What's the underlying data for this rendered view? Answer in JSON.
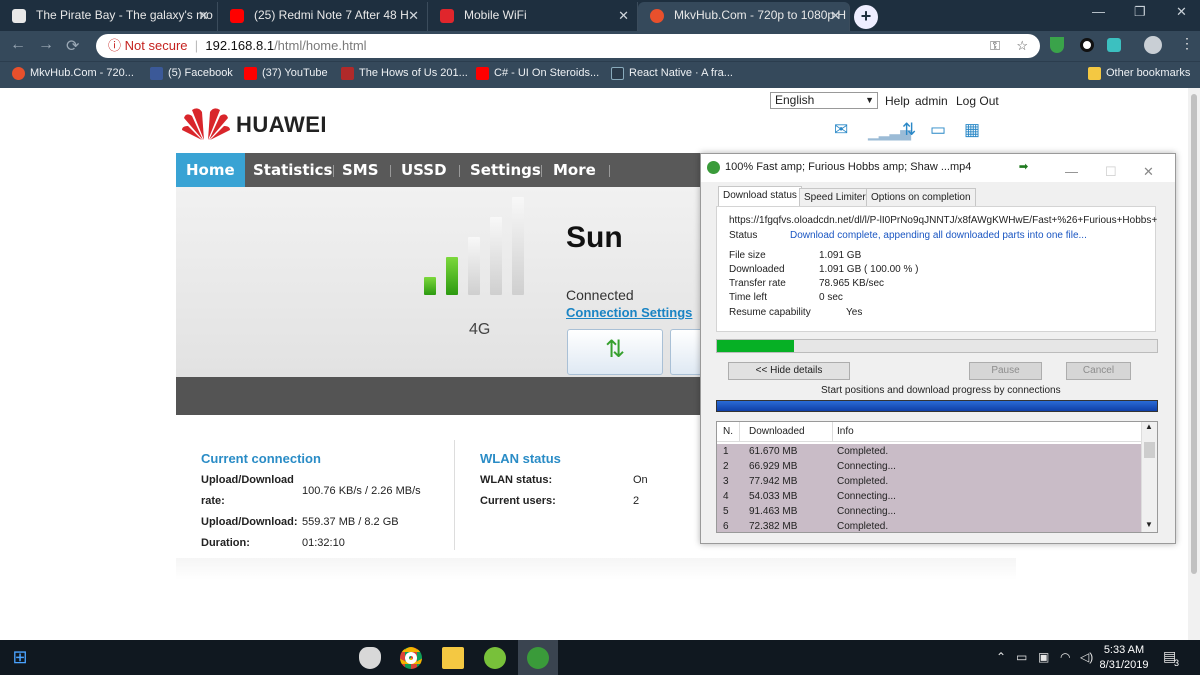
{
  "browser": {
    "tabs": [
      {
        "title": "The Pirate Bay - The galaxy's mo",
        "icon": "pirate-bay-icon",
        "color": "#e8e8e8"
      },
      {
        "title": "(25) Redmi Note 7 After 48 H",
        "icon": "youtube-icon",
        "color": "#ff0000"
      },
      {
        "title": "Mobile WiFi",
        "icon": "huawei-icon",
        "color": "#e0262c"
      },
      {
        "title": "MkvHub.Com - 720p to 1080p H",
        "icon": "mkvhub-icon",
        "color": "#e8502c"
      }
    ],
    "new_tab": "+",
    "address": {
      "warning": "Not secure",
      "host": "192.168.8.1",
      "path": "/html/home.html"
    },
    "bookmarks": [
      {
        "label": "MkvHub.Com - 720...",
        "color": "#e8502c"
      },
      {
        "label": "(5) Facebook",
        "color": "#3b5998"
      },
      {
        "label": "(37) YouTube",
        "color": "#ff0000"
      },
      {
        "label": "The Hows of Us 201...",
        "color": "#b02a2a"
      },
      {
        "label": "C# - UI On Steroids...",
        "color": "#ff0000"
      },
      {
        "label": "React Native · A fra...",
        "color": "#2a3a4a"
      }
    ],
    "other_bookmarks": "Other bookmarks"
  },
  "router": {
    "language": "English",
    "help": "Help",
    "user": "admin",
    "logout": "Log Out",
    "brand": "HUAWEI",
    "nav": [
      "Home",
      "Statistics",
      "SMS",
      "USSD",
      "Settings",
      "More"
    ],
    "operator": "Sun",
    "network_type": "4G",
    "status": "Connected",
    "connection_settings": "Connection Settings",
    "signal_bars_filled": 2,
    "signal_bars_total": 5,
    "current_connection": {
      "title": "Current connection",
      "rate_label": "Upload/Download",
      "rate_label2": "rate:",
      "rate_value": "100.76 KB/s / 2.26 MB/s",
      "volume_label": "Upload/Download:",
      "volume_value": "559.37 MB / 8.2 GB",
      "duration_label": "Duration:",
      "duration_value": "01:32:10"
    },
    "wlan": {
      "title": "WLAN status",
      "status_label": "WLAN status:",
      "status_value": "On",
      "users_label": "Current users:",
      "users_value": "2"
    }
  },
  "idm": {
    "title": "100% Fast amp; Furious Hobbs amp; Shaw ...mp4",
    "tabs": [
      "Download status",
      "Speed Limiter",
      "Options on completion"
    ],
    "url": "https://1fgqfvs.oloadcdn.net/dl/l/P-lI0PrNo9qJNNTJ/x8fAWgKWHwE/Fast+%26+Furious+Hobbs+",
    "status_label": "Status",
    "status_value": "Download complete, appending all downloaded parts into one file...",
    "file_size_label": "File size",
    "file_size": "1.091  GB",
    "downloaded_label": "Downloaded",
    "downloaded": "1.091  GB  ( 100.00 % )",
    "rate_label": "Transfer rate",
    "rate": "78.965  KB/sec",
    "time_left_label": "Time left",
    "time_left": "0 sec",
    "resume_label": "Resume capability",
    "resume": "Yes",
    "progress_fraction": 0.175,
    "hide_details": "<< Hide details",
    "pause": "Pause",
    "cancel": "Cancel",
    "start_positions": "Start positions and download progress by connections",
    "conn_headers": [
      "N.",
      "Downloaded",
      "Info"
    ],
    "connections": [
      {
        "n": "1",
        "downloaded": "61.670  MB",
        "info": "Completed."
      },
      {
        "n": "2",
        "downloaded": "66.929  MB",
        "info": "Connecting..."
      },
      {
        "n": "3",
        "downloaded": "77.942  MB",
        "info": "Completed."
      },
      {
        "n": "4",
        "downloaded": "54.033  MB",
        "info": "Connecting..."
      },
      {
        "n": "5",
        "downloaded": "91.463  MB",
        "info": "Connecting..."
      },
      {
        "n": "6",
        "downloaded": "72.382  MB",
        "info": "Completed."
      }
    ]
  },
  "taskbar": {
    "time": "5:33 AM",
    "date": "8/31/2019",
    "notification_count": "3"
  }
}
